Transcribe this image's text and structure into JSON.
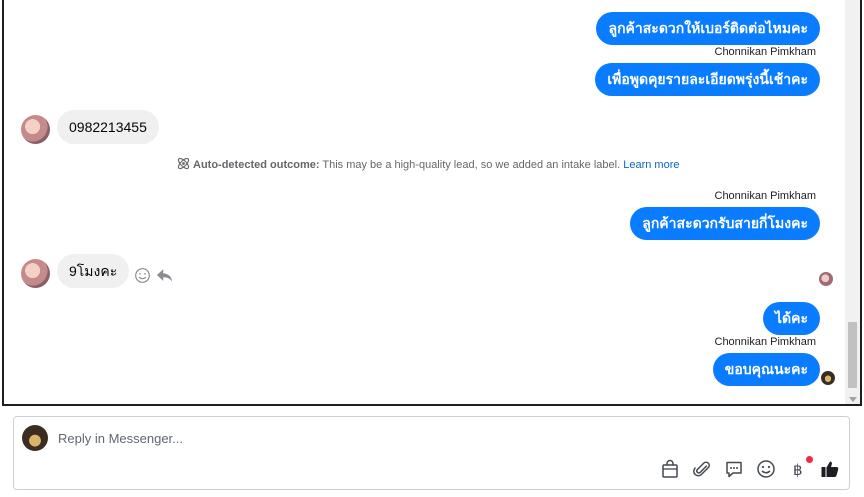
{
  "messages": [
    {
      "text": "ลูกค้าสะดวกให้เบอร์ติดต่อไหมคะ"
    },
    {
      "sender": "Chonnikan Pimkham",
      "text": "เพื่อพูดคุยรายละเอียดพรุ่งนี้เช้าคะ"
    },
    {
      "text": "0982213455"
    },
    {
      "sender": "Chonnikan Pimkham",
      "text": "ลูกค้าสะดวกรับสายกี่โมงคะ"
    },
    {
      "text": "9โมงคะ"
    },
    {
      "text": "ได้คะ"
    },
    {
      "sender": "Chonnikan Pimkham",
      "text": "ขอบคุณนะคะ"
    }
  ],
  "system_notice": {
    "label": "Auto-detected outcome:",
    "text": " This may be a high-quality lead, so we added an intake label.",
    "link": "Learn more"
  },
  "reply": {
    "placeholder": "Reply in Messenger..."
  },
  "colors": {
    "outgoing_bubble": "#0a7cff",
    "incoming_bubble": "#f0f0f0",
    "notification_dot": "#f02849"
  },
  "icons": [
    "gift-bag-icon",
    "paperclip-icon",
    "chat-bubble-icon",
    "smiley-icon",
    "baht-icon",
    "thumbs-up-icon"
  ]
}
